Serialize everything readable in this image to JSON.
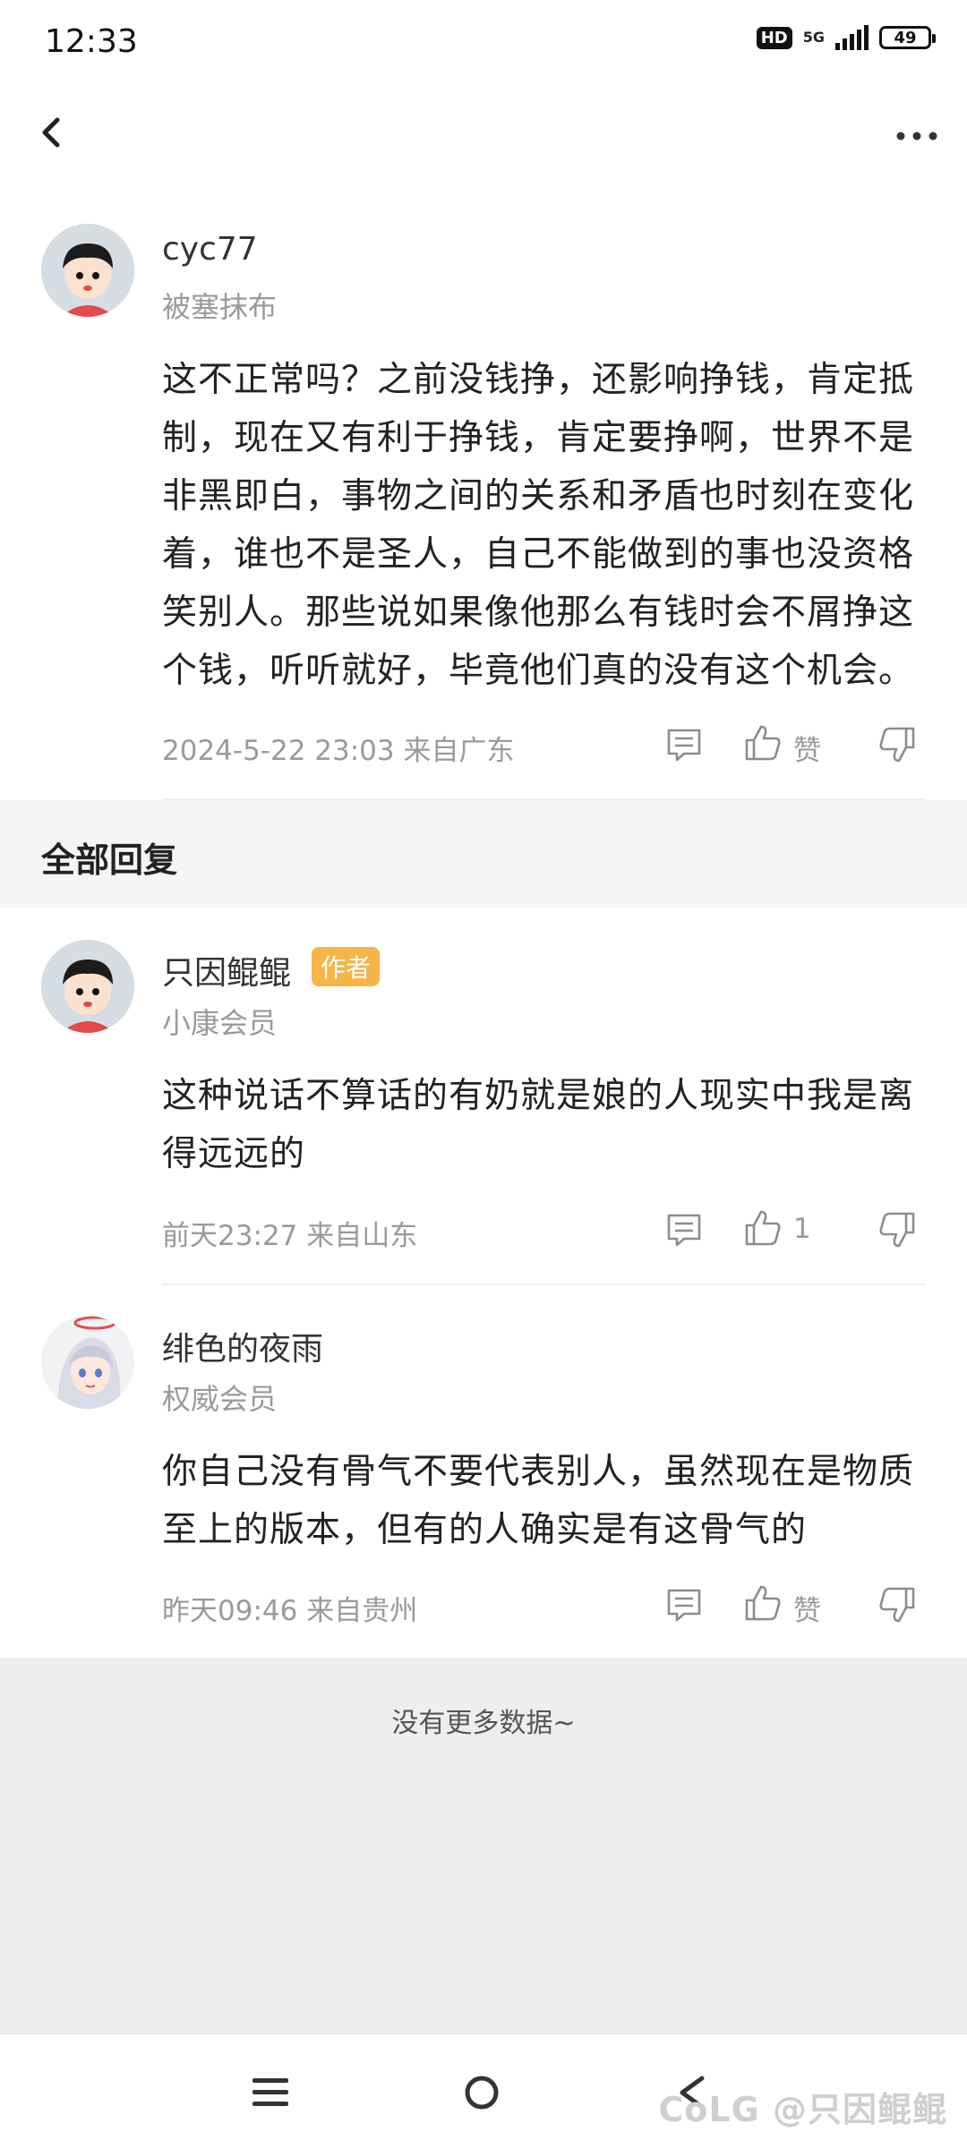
{
  "status_bar": {
    "time": "12:33",
    "hd": "HD",
    "network": "5G",
    "battery": "49",
    "battery_level": 0.49
  },
  "top_nav": {
    "back_icon": "chevron-left-icon",
    "more_icon": "more-horizontal-icon"
  },
  "main_comment": {
    "username": "cyc77",
    "member_level": "被塞抹布",
    "content": "这不正常吗？之前没钱挣，还影响挣钱，肯定抵制，现在又有利于挣钱，肯定要挣啊，世界不是非黑即白，事物之间的关系和矛盾也时刻在变化着，谁也不是圣人，自己不能做到的事也没资格笑别人。那些说如果像他那么有钱时会不屑挣这个钱，听听就好，毕竟他们真的没有这个机会。",
    "meta": "2024-5-22 23:03  来自广东",
    "like_label": "赞"
  },
  "replies_section": {
    "title": "全部回复"
  },
  "replies": [
    {
      "username": "只因鲲鲲",
      "badge": "作者",
      "member_level": "小康会员",
      "content": "这种说话不算话的有奶就是娘的人现实中我是离得远远的",
      "meta": "前天23:27 来自山东",
      "like_label": "1"
    },
    {
      "username": "绯色的夜雨",
      "member_level": "权威会员",
      "content": "你自己没有骨气不要代表别人，虽然现在是物质至上的版本，但有的人确实是有这骨气的",
      "meta": "昨天09:46 来自贵州",
      "like_label": "赞"
    }
  ],
  "footer": {
    "no_more": "没有更多数据~"
  },
  "watermark": "CoLG @只因鲲鲲",
  "colors": {
    "accent_badge": "#f5b548",
    "meta_gray": "#9a9a9a"
  }
}
